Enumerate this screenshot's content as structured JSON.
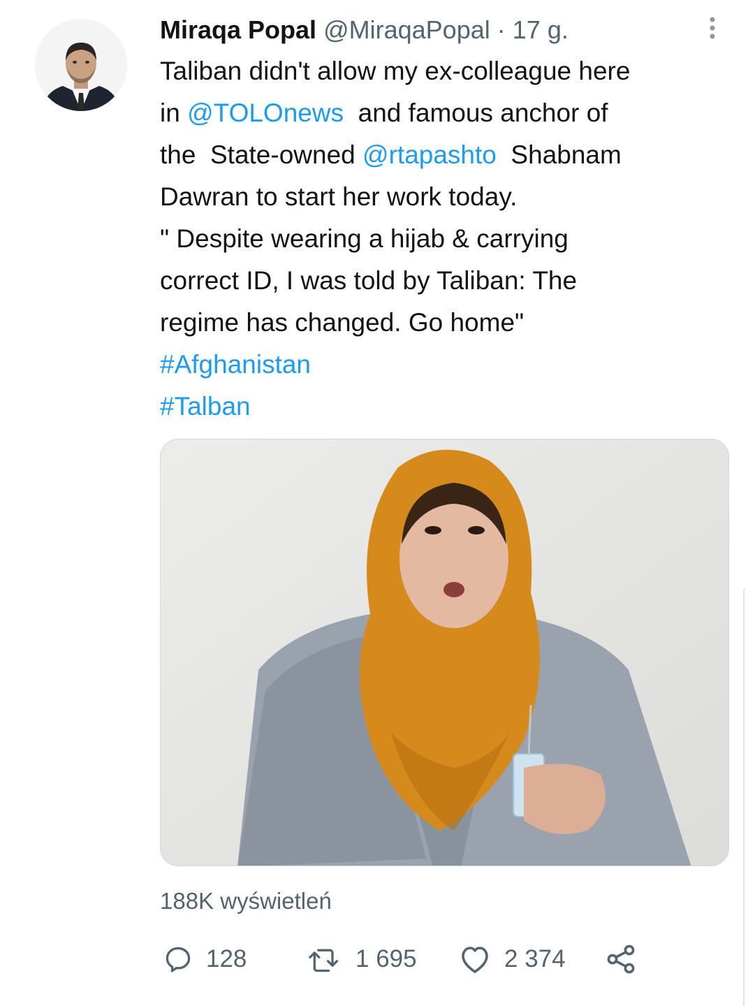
{
  "author": {
    "name": "Miraqa Popal",
    "handle": "@MiraqaPopal",
    "separator": "·",
    "time": "17 g.",
    "avatar_icon": "profile-photo-man-in-suit"
  },
  "tweet": {
    "lines": [
      [
        {
          "t": "Taliban didn't allow my ex-colleague here"
        }
      ],
      [
        {
          "t": "in "
        },
        {
          "t": "@TOLOnews",
          "link": true
        },
        {
          "t": "  and famous anchor of"
        }
      ],
      [
        {
          "t": "the  State-owned "
        },
        {
          "t": "@rtapashto",
          "link": true
        },
        {
          "t": "  Shabnam"
        }
      ],
      [
        {
          "t": "Dawran to start her work today."
        }
      ],
      [
        {
          "t": "\" Despite wearing a hijab & carrying"
        }
      ],
      [
        {
          "t": "correct ID, I was told by Taliban: The"
        }
      ],
      [
        {
          "t": "regime has changed. Go home\""
        }
      ],
      [
        {
          "t": "#Afghanistan",
          "link": true
        }
      ],
      [
        {
          "t": "#Talban",
          "link": true
        }
      ]
    ]
  },
  "media": {
    "icon": "video-still-woman-orange-headscarf-grey-jacket"
  },
  "stats": {
    "views": "188K wyświetleń"
  },
  "actions": {
    "reply_count": "128",
    "retweet_count": "1 695",
    "like_count": "2 374"
  },
  "colors": {
    "link": "#1d9bf0",
    "secondary_text": "#536471",
    "primary_text": "#0f1419",
    "headscarf": "#d68a1c",
    "jacket": "#9aa3ad"
  }
}
